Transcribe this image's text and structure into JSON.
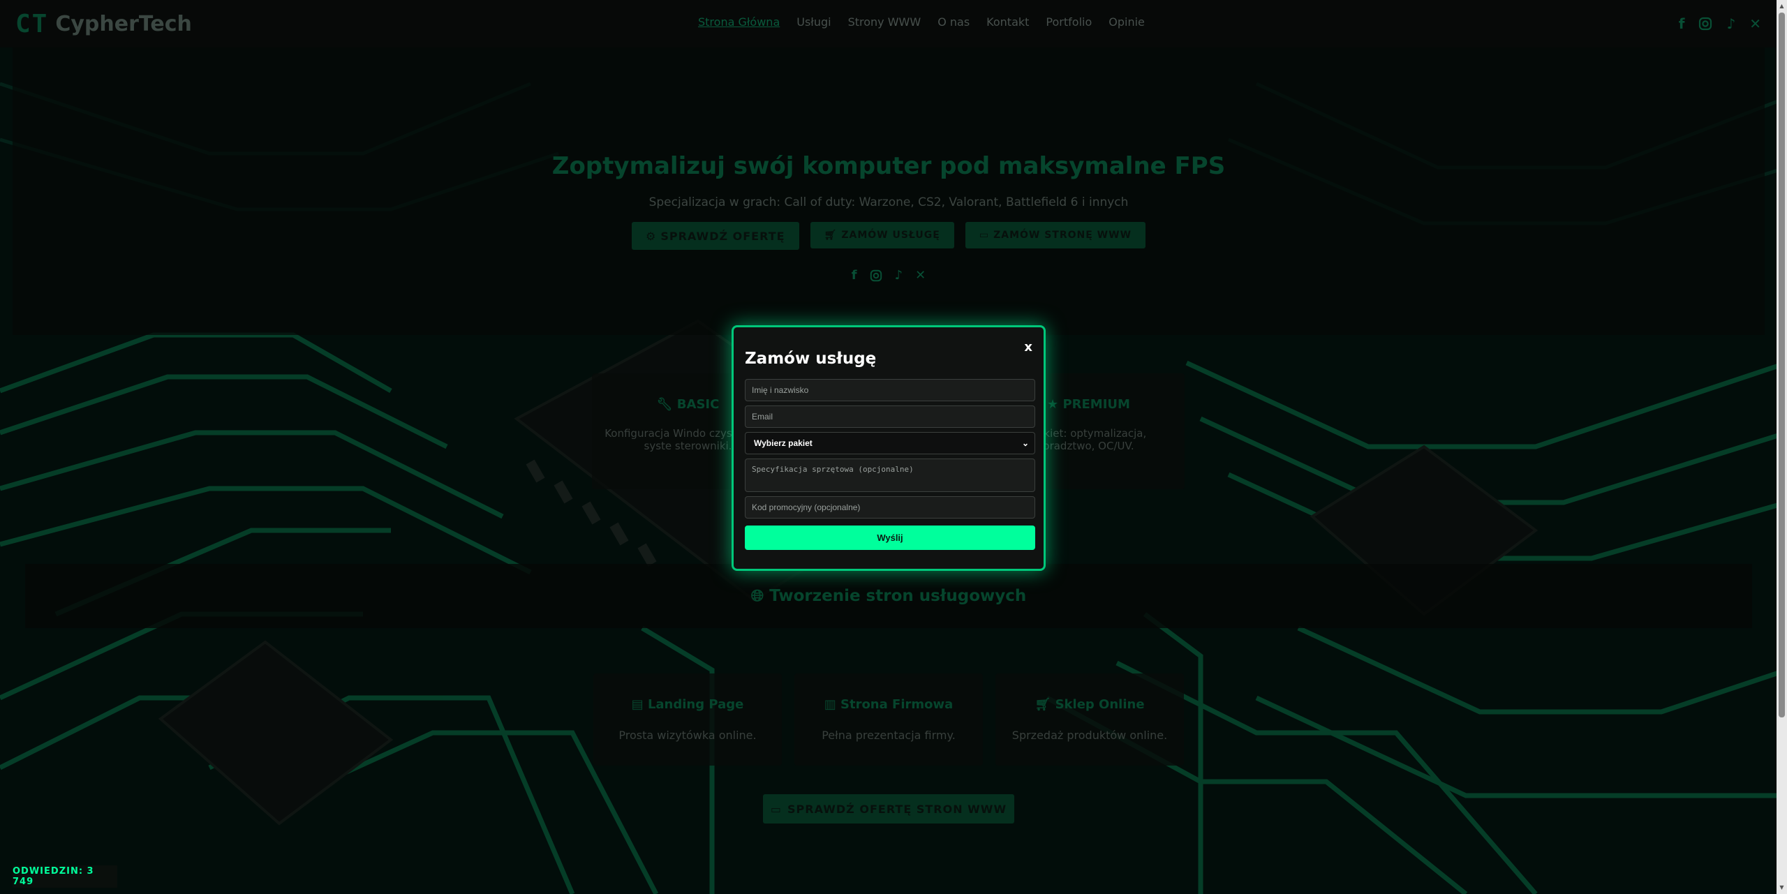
{
  "brand": {
    "mark": "CT",
    "name": "CypherTech"
  },
  "nav": [
    {
      "label": "Strona Główna",
      "active": true
    },
    {
      "label": "Usługi"
    },
    {
      "label": "Strony WWW"
    },
    {
      "label": "O nas"
    },
    {
      "label": "Kontakt"
    },
    {
      "label": "Portfolio"
    },
    {
      "label": "Opinie"
    }
  ],
  "social_icons": [
    "facebook-icon",
    "instagram-icon",
    "tiktok-icon",
    "x-icon"
  ],
  "hero": {
    "title": "Zoptymalizuj swój komputer pod maksymalne FPS",
    "subtitle": "Specjalizacja w grach: Call of duty: Warzone, CS2, Valorant, Battlefield 6 i innych",
    "buttons": [
      {
        "label": "SPRAWDŹ OFERTĘ",
        "icon": "cogs-icon"
      },
      {
        "label": "ZAMÓW USŁUGĘ",
        "icon": "cart-icon"
      },
      {
        "label": "ZAMÓW STRONĘ WWW",
        "icon": "laptop-icon"
      }
    ]
  },
  "packages": [
    {
      "title": "BASIC",
      "icon": "wrench-icon",
      "desc": "Konfiguracja Windo czyszczenie syste sterowniki."
    },
    {
      "title": "PREMIUM",
      "icon": "star-icon",
      "desc": "pakiet: optymalizacja, oradztwo, OC/UV."
    }
  ],
  "web": {
    "title": "Tworzenie stron usługowych",
    "cards": [
      {
        "title": "Landing Page",
        "icon": "file-icon",
        "desc": "Prosta wizytówka online."
      },
      {
        "title": "Strona Firmowa",
        "icon": "building-icon",
        "desc": "Pełna prezentacja firmy."
      },
      {
        "title": "Sklep Online",
        "icon": "cart-icon",
        "desc": "Sprzedaż produktów online."
      }
    ],
    "offer_button": "SPRAWDŹ OFERTĘ STRON WWW"
  },
  "visits": "ODWIEDZIN: 3 749",
  "modal": {
    "title": "Zamów usługę",
    "close": "x",
    "name_placeholder": "Imię i nazwisko",
    "email_placeholder": "Email",
    "package_selected": "Wybierz pakiet",
    "spec_placeholder": "Specyfikacja sprzętowa (opcjonalne)",
    "promo_placeholder": "Kod promocyjny (opcjonalne)",
    "submit": "Wyślij"
  },
  "colors": {
    "accent": "#00ff9c",
    "dim_accent": "#0a6b46",
    "modal_border": "#00c77a",
    "background": "#050a08"
  }
}
